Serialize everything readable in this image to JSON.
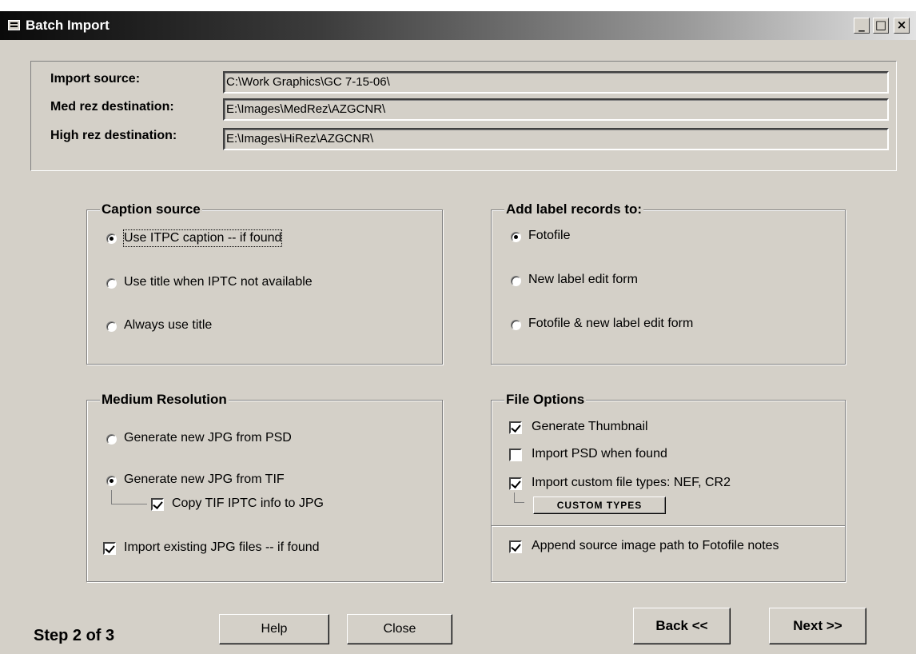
{
  "window": {
    "title": "Batch Import",
    "controls": {
      "minimize": "_",
      "maximize": "□",
      "close": "×"
    }
  },
  "paths": {
    "import_source_label": "Import source:",
    "import_source_value": "C:\\Work Graphics\\GC 7-15-06\\",
    "med_rez_label": "Med rez destination:",
    "med_rez_value": "E:\\Images\\MedRez\\AZGCNR\\",
    "high_rez_label": "High rez destination:",
    "high_rez_value": "E:\\Images\\HiRez\\AZGCNR\\"
  },
  "caption_source": {
    "title": "Caption source",
    "options": [
      {
        "label": "Use ITPC caption -- if found",
        "selected": true
      },
      {
        "label": "Use title when IPTC not available",
        "selected": false
      },
      {
        "label": "Always use title",
        "selected": false
      }
    ]
  },
  "label_records": {
    "title": "Add label records to:",
    "options": [
      {
        "label": "Fotofile",
        "selected": true
      },
      {
        "label": "New label edit form",
        "selected": false
      },
      {
        "label": "Fotofile & new label edit form",
        "selected": false
      }
    ]
  },
  "medium_resolution": {
    "title": "Medium Resolution",
    "gen_psd": {
      "label": "Generate new JPG from PSD",
      "selected": false
    },
    "gen_tif": {
      "label": "Generate new JPG from TIF",
      "selected": true
    },
    "copy_tif_iptc": {
      "label": "Copy TIF IPTC info to JPG",
      "checked": true
    },
    "import_existing": {
      "label": "Import existing JPG files -- if found",
      "checked": true
    }
  },
  "file_options": {
    "title": "File Options",
    "thumbnail": {
      "label": "Generate Thumbnail",
      "checked": true
    },
    "import_psd": {
      "label": "Import PSD when found",
      "checked": false
    },
    "custom_types": {
      "label": "Import custom file types: NEF, CR2",
      "checked": true
    },
    "custom_types_button": "CUSTOM TYPES",
    "append_path": {
      "label": "Append source image path to Fotofile notes",
      "checked": true
    }
  },
  "footer": {
    "step": "Step 2 of 3",
    "help": "Help",
    "close": "Close",
    "back": "Back <<",
    "next": "Next >>"
  }
}
